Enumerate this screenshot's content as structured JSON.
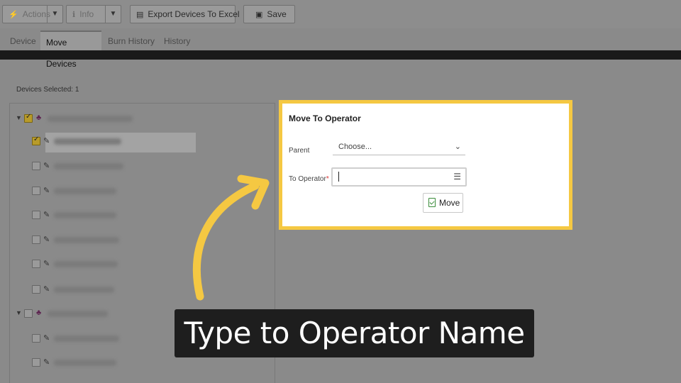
{
  "toolbar": {
    "actions_label": "Actions",
    "info_label": "Info",
    "export_label": "Export Devices To Excel",
    "save_label": "Save"
  },
  "tabs": [
    {
      "label": "Device"
    },
    {
      "label": "Move Devices"
    },
    {
      "label": "Burn History"
    },
    {
      "label": "History"
    }
  ],
  "devices_selected": "Devices Selected: 1",
  "move_panel": {
    "title": "Move To Operator",
    "parent_label": "Parent",
    "parent_value": "Choose...",
    "to_operator_label": "To Operator",
    "required_mark": "*",
    "to_operator_value": "",
    "move_label": "Move"
  },
  "caption": "Type to Operator Name",
  "colors": {
    "highlight_border": "#f5c842",
    "arrow": "#f5c842",
    "caption_bg": "#1e1e1e",
    "move_icon": "#3a8c3a"
  },
  "icons": [
    "bolt-icon",
    "info-icon",
    "chevron-down-icon",
    "excel-icon",
    "save-icon",
    "hierarchy-icon",
    "device-icon",
    "list-icon",
    "move-icon",
    "curved-arrow"
  ]
}
